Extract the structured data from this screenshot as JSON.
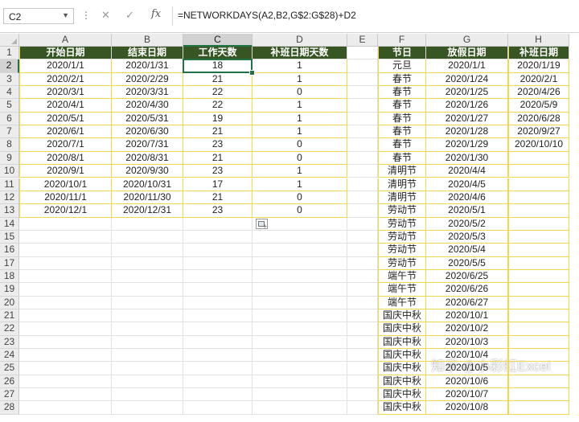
{
  "formula_bar": {
    "name_box": "C2",
    "cancel_glyph": "✕",
    "enter_glyph": "✓",
    "fx_label": "fx",
    "formula": "=NETWORKDAYS(A2,B2,G$2:G$28)+D2"
  },
  "columns": [
    "A",
    "B",
    "C",
    "D",
    "E",
    "F",
    "G",
    "H"
  ],
  "selected_column": "C",
  "selected_row": 2,
  "rows": [
    "1",
    "2",
    "3",
    "4",
    "5",
    "6",
    "7",
    "8",
    "9",
    "10",
    "11",
    "12",
    "13",
    "14",
    "15",
    "16",
    "17",
    "18",
    "19",
    "20",
    "21",
    "22",
    "23",
    "24",
    "25",
    "26",
    "27",
    "28"
  ],
  "left_table": {
    "headers": [
      "开始日期",
      "结束日期",
      "工作天数",
      "补班日期天数"
    ],
    "rows": [
      [
        "2020/1/1",
        "2020/1/31",
        "18",
        "1"
      ],
      [
        "2020/2/1",
        "2020/2/29",
        "21",
        "1"
      ],
      [
        "2020/3/1",
        "2020/3/31",
        "22",
        "0"
      ],
      [
        "2020/4/1",
        "2020/4/30",
        "22",
        "1"
      ],
      [
        "2020/5/1",
        "2020/5/31",
        "19",
        "1"
      ],
      [
        "2020/6/1",
        "2020/6/30",
        "21",
        "1"
      ],
      [
        "2020/7/1",
        "2020/7/31",
        "23",
        "0"
      ],
      [
        "2020/8/1",
        "2020/8/31",
        "21",
        "0"
      ],
      [
        "2020/9/1",
        "2020/9/30",
        "23",
        "1"
      ],
      [
        "2020/10/1",
        "2020/10/31",
        "17",
        "1"
      ],
      [
        "2020/11/1",
        "2020/11/30",
        "21",
        "0"
      ],
      [
        "2020/12/1",
        "2020/12/31",
        "23",
        "0"
      ]
    ]
  },
  "holiday_table": {
    "headers": [
      "节日",
      "放假日期"
    ],
    "rows": [
      [
        "元旦",
        "2020/1/1"
      ],
      [
        "春节",
        "2020/1/24"
      ],
      [
        "春节",
        "2020/1/25"
      ],
      [
        "春节",
        "2020/1/26"
      ],
      [
        "春节",
        "2020/1/27"
      ],
      [
        "春节",
        "2020/1/28"
      ],
      [
        "春节",
        "2020/1/29"
      ],
      [
        "春节",
        "2020/1/30"
      ],
      [
        "清明节",
        "2020/4/4"
      ],
      [
        "清明节",
        "2020/4/5"
      ],
      [
        "清明节",
        "2020/4/6"
      ],
      [
        "劳动节",
        "2020/5/1"
      ],
      [
        "劳动节",
        "2020/5/2"
      ],
      [
        "劳动节",
        "2020/5/3"
      ],
      [
        "劳动节",
        "2020/5/4"
      ],
      [
        "劳动节",
        "2020/5/5"
      ],
      [
        "端午节",
        "2020/6/25"
      ],
      [
        "端午节",
        "2020/6/26"
      ],
      [
        "端午节",
        "2020/6/27"
      ],
      [
        "国庆中秋",
        "2020/10/1"
      ],
      [
        "国庆中秋",
        "2020/10/2"
      ],
      [
        "国庆中秋",
        "2020/10/3"
      ],
      [
        "国庆中秋",
        "2020/10/4"
      ],
      [
        "国庆中秋",
        "2020/10/5"
      ],
      [
        "国庆中秋",
        "2020/10/6"
      ],
      [
        "国庆中秋",
        "2020/10/7"
      ],
      [
        "国庆中秋",
        "2020/10/8"
      ]
    ]
  },
  "makeup_table": {
    "header": "补班日期",
    "rows": [
      "2020/1/19",
      "2020/2/1",
      "2020/4/26",
      "2020/5/9",
      "2020/6/28",
      "2020/9/27",
      "2020/10/10"
    ]
  },
  "watermark": "知乎 @小彩虹Excel",
  "colors": {
    "header_fill": "#375623",
    "header_text": "#ffffff",
    "table_border": "#f0d74b",
    "selection": "#217346"
  }
}
